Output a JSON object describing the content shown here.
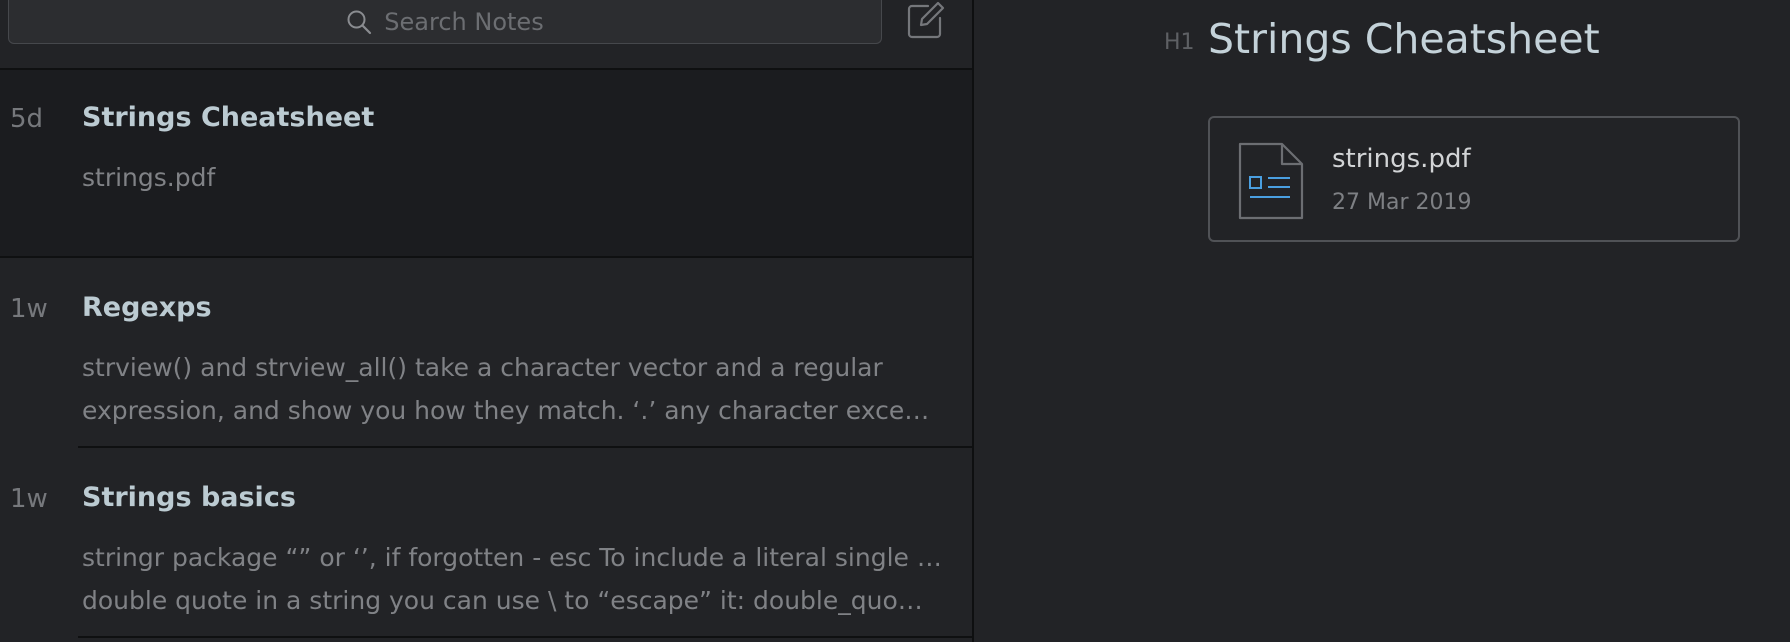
{
  "search": {
    "placeholder": "Search Notes",
    "icon": "search-icon"
  },
  "toolbar": {
    "compose_icon": "compose-icon"
  },
  "notes": [
    {
      "age": "5d",
      "title": "Strings Cheatsheet",
      "snippet_lines": [
        "strings.pdf"
      ],
      "selected": true
    },
    {
      "age": "1w",
      "title": "Regexps",
      "snippet_lines": [
        "strview() and strview_all() take a character vector and a regular",
        "expression, and show you how they match. ‘.’ any character excep…"
      ],
      "selected": false
    },
    {
      "age": "1w",
      "title": "Strings basics",
      "snippet_lines": [
        "stringr package “” or ‘’, if forgotten - esc To include a literal single or",
        "double quote in a string you can use \\ to “escape” it: double_quo…"
      ],
      "selected": false
    }
  ],
  "editor": {
    "heading_marker": "H1",
    "heading": "Strings Cheatsheet",
    "attachment": {
      "file_name": "strings.pdf",
      "date": "27 Mar 2019",
      "icon": "pdf-file-icon"
    }
  },
  "colors": {
    "background": "#222326",
    "selected_row": "#1b1c1f",
    "title_text": "#bccbd2",
    "accent_blue": "#4a9fe0"
  }
}
